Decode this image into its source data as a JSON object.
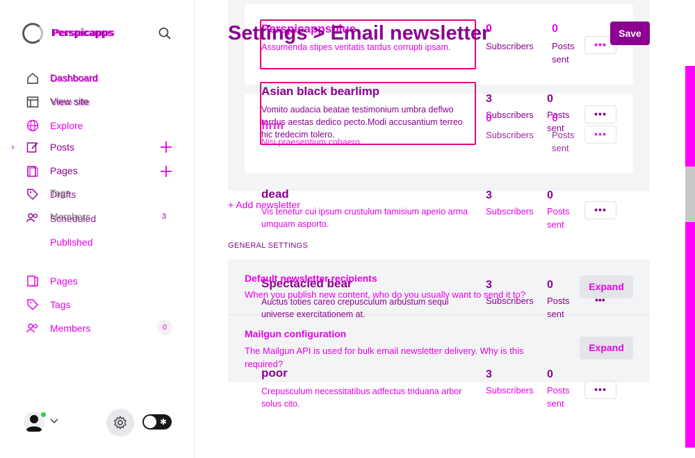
{
  "brand": {
    "name": "Perspicapps",
    "name_ghost": "Perspicapps"
  },
  "nav": {
    "dashboard": "Dashboard",
    "dashboard_ghost": "Dashboard",
    "view_site": "View site",
    "view_site_ghost": "View site",
    "explore": "Explore",
    "posts": "Posts",
    "pages_ghost": "Pages",
    "drafts": "Drafts",
    "tags_ghost": "Tags",
    "scheduled": "Scheduled",
    "members_ghost": "Members",
    "members_ghost_count": "3",
    "published": "Published",
    "pages": "Pages",
    "tags": "Tags",
    "members": "Members",
    "members_count": "0"
  },
  "header": {
    "title": "Settings > Email newsletter",
    "save_label": "Save"
  },
  "newsletters": [
    {
      "name": "Perspicappsblue",
      "desc": "Assumenda stipes veritatis tardus corrupti ipsam.",
      "subscribers": "0",
      "subscribers_label": "Subscribers",
      "posts": "0",
      "posts_label": "Posts sent"
    },
    {
      "name": "Asian black bearlimp",
      "desc": "Vomito audacia beatae testimonium umbra deflwo tardus aestas dedico pecto.Modi accusantium terreo hic tredecim tolero.",
      "subscribers": "3",
      "subscribers_label": "Subscribers",
      "posts": "0",
      "posts_label": "Posts sent"
    },
    {
      "name": "firm",
      "desc": "Nisi praesentium cohaero.",
      "subscribers": "0",
      "subscribers_label": "Subscribers",
      "posts": "0",
      "posts_label": "Posts sent"
    },
    {
      "name": "dead",
      "desc": "Vis tenetur cui ipsum crustulum tamisium aperio arma umquam asporto.",
      "subscribers": "3",
      "subscribers_label": "Subscribers",
      "posts": "0",
      "posts_label": "Posts sent"
    },
    {
      "name": "Spectacled bear",
      "desc": "Auctus toties careo crepusculum arbustum sequi universe exercitationem at.",
      "subscribers": "3",
      "subscribers_label": "Subscribers",
      "posts": "0",
      "posts_label": "Posts sent"
    },
    {
      "name": "poor",
      "desc": "Crepusculum necessitatibus adfectus triduana arbor solus cito.",
      "subscribers": "3",
      "subscribers_label": "Subscribers",
      "posts": "0",
      "posts_label": "Posts sent"
    }
  ],
  "more_glyph": "•••",
  "add_newsletter": "+ Add newsletter",
  "general": {
    "heading": "GENERAL SETTINGS",
    "default_title": "Default newsletter recipients",
    "default_desc": "When you publish new content, who do you usually want to send it to?",
    "mailgun_title": "Mailgun configuration",
    "mailgun_desc": "The Mailgun API is used for bulk email newsletter delivery. Why is this required?",
    "expand_label": "Expand"
  },
  "colors": {
    "accent": "#8b0090",
    "magenta": "#e600e6",
    "outline": "#e6007e",
    "status_online": "#30cf43"
  },
  "icons": {
    "search": "search-icon",
    "home": "home-icon",
    "view_site": "browser-window-icon",
    "explore": "globe-icon",
    "posts": "pencil-square-icon",
    "pages": "pages-icon",
    "tags": "tag-icon",
    "members": "members-icon",
    "settings": "gear-icon",
    "night_toggle": "night-mode-toggle"
  }
}
